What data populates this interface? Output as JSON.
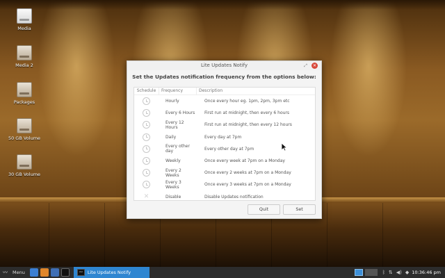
{
  "desktop": {
    "icons": [
      {
        "label": "Media"
      },
      {
        "label": "Media 2"
      },
      {
        "label": "Packages"
      },
      {
        "label": "50 GB Volume"
      },
      {
        "label": "30 GB Volume"
      }
    ]
  },
  "dialog": {
    "title": "Lite Updates Notify",
    "heading": "Set the Updates notification frequency from the options below:",
    "columns": {
      "schedule": "Schedule",
      "frequency": "Frequency",
      "description": "Description"
    },
    "rows": [
      {
        "frequency": "Hourly",
        "description": "Once every hour eg. 1pm, 2pm, 3pm etc",
        "icon": "clock-icon"
      },
      {
        "frequency": "Every 6 Hours",
        "description": "First run at midnight, then every 6 hours",
        "icon": "clock-icon"
      },
      {
        "frequency": "Every 12 Hours",
        "description": "First run at midnight, then every 12 hours",
        "icon": "clock-icon"
      },
      {
        "frequency": "Daily",
        "description": "Every day at 7pm",
        "icon": "clock-icon"
      },
      {
        "frequency": "Every other day",
        "description": "Every other day at 7pm",
        "icon": "clock-icon"
      },
      {
        "frequency": "Weekly",
        "description": "Once every week at 7pm on a Monday",
        "icon": "clock-icon"
      },
      {
        "frequency": "Every 2 Weeks",
        "description": "Once every 2 weeks at 7pm on a Monday",
        "icon": "clock-icon"
      },
      {
        "frequency": "Every 3 Weeks",
        "description": "Once every 3 weeks at 7pm on a Monday",
        "icon": "clock-icon"
      },
      {
        "frequency": "Disable",
        "description": "Disable Updates notification",
        "icon": "x-icon"
      }
    ],
    "buttons": {
      "quit": "Quit",
      "set": "Set"
    }
  },
  "taskbar": {
    "menu_label": "Menu",
    "active_task": "Lite Updates Notify",
    "clock": "10:36:46 pm",
    "accent": "#2f86d1"
  }
}
